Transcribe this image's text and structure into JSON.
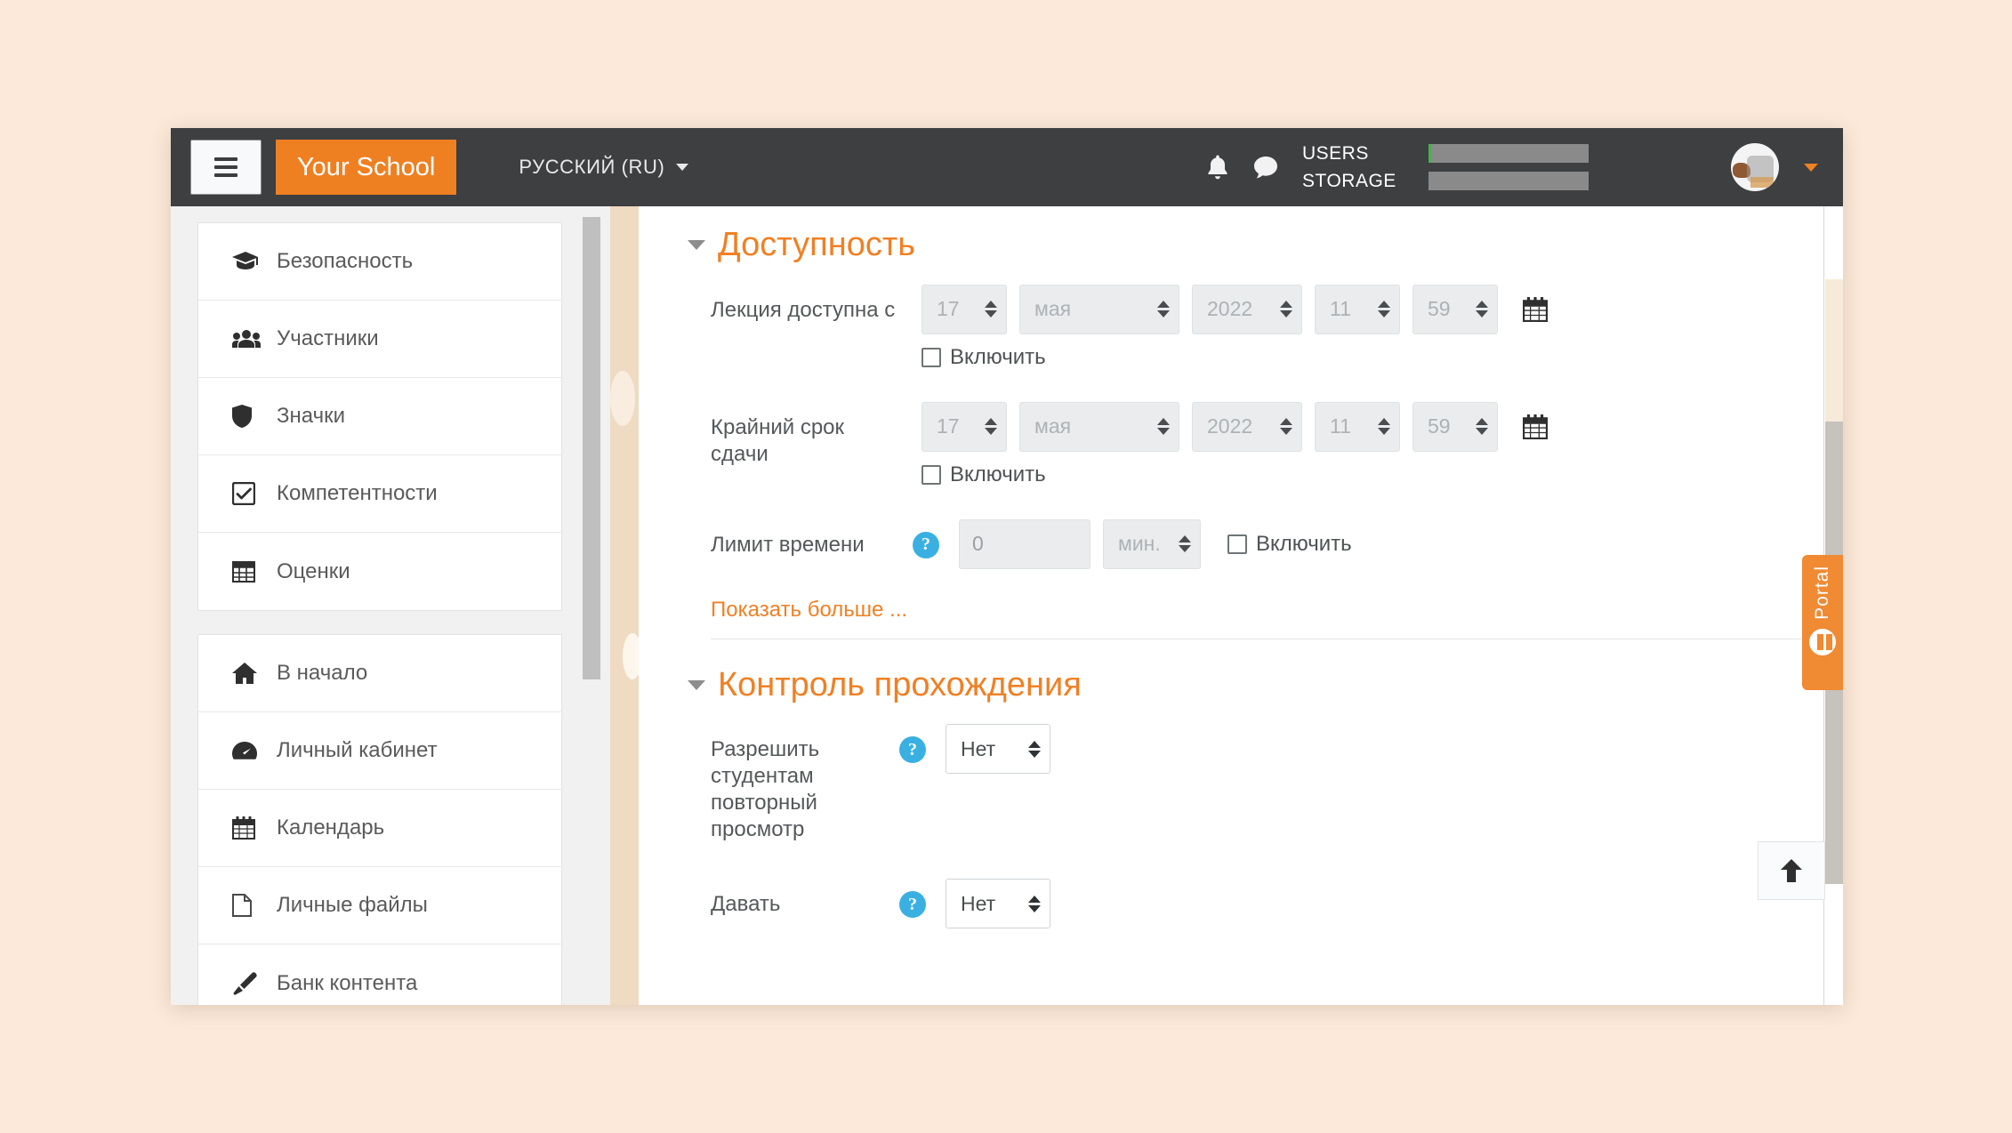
{
  "navbar": {
    "menu_icon": "hamburger-icon",
    "brand_label": "Your School",
    "language_label": "РУССКИЙ (RU)",
    "notifications_icon": "bell-icon",
    "messages_icon": "chat-bubble-icon",
    "quota": [
      {
        "label": "USERS",
        "bar_accent": "#4caf50"
      },
      {
        "label": "STORAGE",
        "bar_accent": "#8a8a8a"
      }
    ],
    "avatar_icon": "user-avatar",
    "user_menu_icon": "caret-down-icon",
    "bg_color": "#3d3f41",
    "brand_color": "#ef8022"
  },
  "sidebar": {
    "groups": [
      {
        "items": [
          {
            "label": "Безопасность",
            "icon": "graduation-cap-icon"
          },
          {
            "label": "Участники",
            "icon": "users-icon"
          },
          {
            "label": "Значки",
            "icon": "shield-icon"
          },
          {
            "label": "Компетентности",
            "icon": "check-square-icon"
          },
          {
            "label": "Оценки",
            "icon": "table-icon"
          }
        ]
      },
      {
        "items": [
          {
            "label": "В начало",
            "icon": "home-icon"
          },
          {
            "label": "Личный кабинет",
            "icon": "dashboard-icon"
          },
          {
            "label": "Календарь",
            "icon": "calendar-icon"
          },
          {
            "label": "Личные файлы",
            "icon": "file-icon"
          },
          {
            "label": "Банк контента",
            "icon": "brush-icon"
          }
        ]
      }
    ]
  },
  "main": {
    "sections": [
      {
        "title": "Доступность",
        "collapse_icon": "caret-down-icon"
      },
      {
        "title": "Контроль прохождения",
        "collapse_icon": "caret-down-icon"
      }
    ],
    "availability": {
      "open_row": {
        "label": "Лекция доступна с",
        "day": "17",
        "month": "мая",
        "year": "2022",
        "hour": "11",
        "minute": "59",
        "calendar_icon": "calendar-icon",
        "enable_label": "Включить",
        "enabled": false
      },
      "deadline_row": {
        "label": "Крайний срок сдачи",
        "day": "17",
        "month": "мая",
        "year": "2022",
        "hour": "11",
        "minute": "59",
        "calendar_icon": "calendar-icon",
        "enable_label": "Включить",
        "enabled": false
      },
      "time_limit_row": {
        "label": "Лимит времени",
        "help_icon": "help-circle-icon",
        "value": "0",
        "unit": "мин.",
        "enable_label": "Включить",
        "enabled": false
      },
      "show_more_label": "Показать больше ..."
    },
    "flow_control": {
      "retake_row": {
        "label": "Разрешить студентам повторный просмотр",
        "help_icon": "help-circle-icon",
        "value": "Нет"
      },
      "second_row": {
        "label": "Давать",
        "help_icon": "help-circle-icon",
        "value": "Нет"
      }
    }
  },
  "widgets": {
    "portal_tab_label": "Portal",
    "portal_tab_icon": "portal-mark-icon",
    "portal_tab_color": "#f08a33",
    "scroll_top_icon": "arrow-up-icon"
  }
}
